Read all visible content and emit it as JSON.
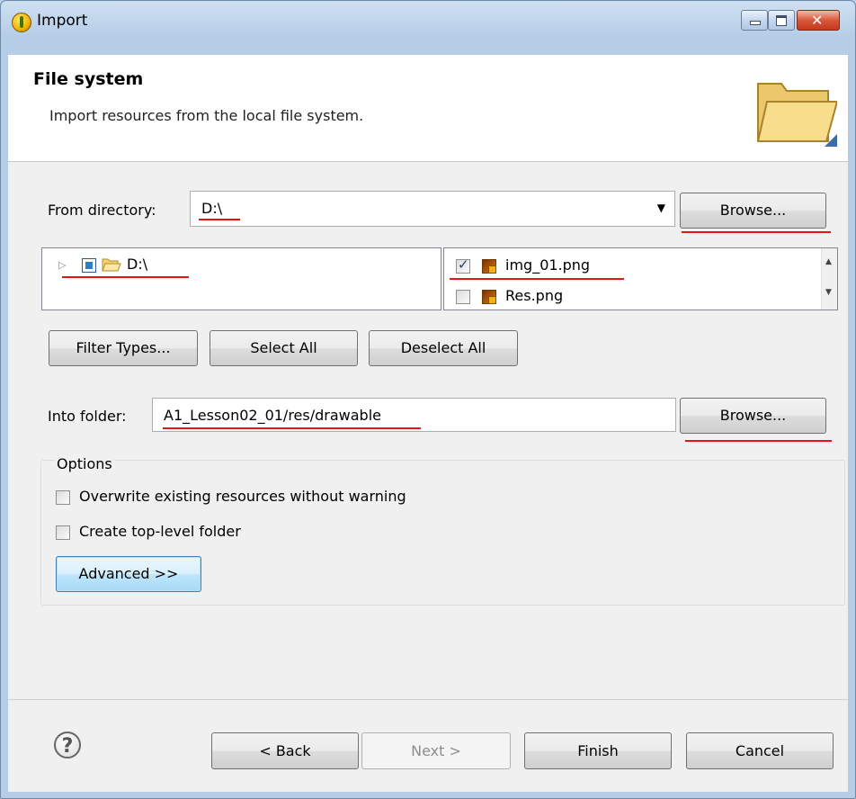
{
  "window": {
    "title": "Import"
  },
  "header": {
    "title": "File system",
    "description": "Import resources from the local file system."
  },
  "from_directory": {
    "label": "From directory:",
    "value": "D:\\",
    "browse_label": "Browse..."
  },
  "tree": {
    "items": [
      {
        "label": "D:\\",
        "checked": false,
        "partial": true
      }
    ]
  },
  "files": {
    "items": [
      {
        "label": "img_01.png",
        "checked": true
      },
      {
        "label": "Res.png",
        "checked": false
      }
    ]
  },
  "selection_buttons": {
    "filter_types": "Filter Types...",
    "select_all": "Select All",
    "deselect_all": "Deselect All"
  },
  "into_folder": {
    "label": "Into folder:",
    "value": "A1_Lesson02_01/res/drawable",
    "browse_label": "Browse..."
  },
  "options": {
    "legend": "Options",
    "overwrite_label": "Overwrite existing resources without warning",
    "overwrite_checked": false,
    "toplevel_label": "Create top-level folder",
    "toplevel_checked": false,
    "advanced_label": "Advanced >>"
  },
  "footer": {
    "help_glyph": "?",
    "back_label": "< Back",
    "next_label": "Next >",
    "finish_label": "Finish",
    "cancel_label": "Cancel"
  },
  "colors": {
    "annotation_underline": "#e11111",
    "titlebar": "#b9d1ea"
  }
}
